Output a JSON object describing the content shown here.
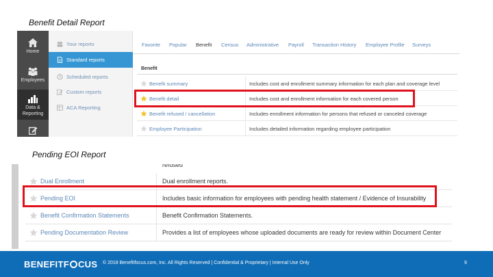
{
  "titles": {
    "benefit_detail": "Benefit Detail Report",
    "pending_eoi": "Pending EOI Report"
  },
  "sidebar": {
    "items": [
      {
        "label": "Home",
        "icon": "home-icon"
      },
      {
        "label": "Employees",
        "icon": "people-icon"
      },
      {
        "label": "Data & Reporting",
        "icon": "bar-chart-icon"
      },
      {
        "label": "",
        "icon": "edit-icon"
      }
    ]
  },
  "submenu": {
    "items": [
      {
        "label": "Your reports",
        "icon": "users-icon"
      },
      {
        "label": "Standard reports",
        "icon": "document-icon"
      },
      {
        "label": "Scheduled reports",
        "icon": "clock-icon"
      },
      {
        "label": "Custom reports",
        "icon": "pencil-icon"
      },
      {
        "label": "ACA Reporting",
        "icon": "table-icon"
      }
    ]
  },
  "tabs": [
    "Favorite",
    "Popular",
    "Benefit",
    "Census",
    "Administrative",
    "Payroll",
    "Transaction History",
    "Employee Profile",
    "Surveys"
  ],
  "benefit_section": {
    "heading": "Benefit",
    "rows": [
      {
        "name": "Benefit summary",
        "desc": "Includes cost and enrollment summary information for each plan and coverage level"
      },
      {
        "name": "Benefit detail",
        "desc": "Includes cost and enrollment information for each covered person"
      },
      {
        "name": "Benefit refused / cancellation",
        "desc": "Includes enrollment information for persons that refused or canceled coverage"
      },
      {
        "name": "Employee Participation",
        "desc": "Includes detailed information regarding employee participation"
      }
    ]
  },
  "pending_section": {
    "cut_text": "refused",
    "rows": [
      {
        "name": "Dual Enrollment",
        "desc": "Dual enrollment reports."
      },
      {
        "name": "Pending EOI",
        "desc": "Includes basic information for employees with pending health statement / Evidence of Insurability"
      },
      {
        "name": "Benefit Confirmation Statements",
        "desc": "Benefit Confirmation Statements."
      },
      {
        "name": "Pending Documentation Review",
        "desc": "Provides a list of employees whose uploaded documents are ready for review within Document Center"
      }
    ]
  },
  "footer": {
    "logo_part1": "BENEFITF",
    "logo_part2": "CUS",
    "copyright": "© 2018 Benefitfocus.com, Inc. All Rights Reserved | Confidential & Proprietary | Internal Use Only",
    "page": "9"
  },
  "colors": {
    "highlight": "#e0111b",
    "active_submenu": "#3596d3",
    "footer": "#0f6cb6",
    "link": "#5b86b8"
  }
}
